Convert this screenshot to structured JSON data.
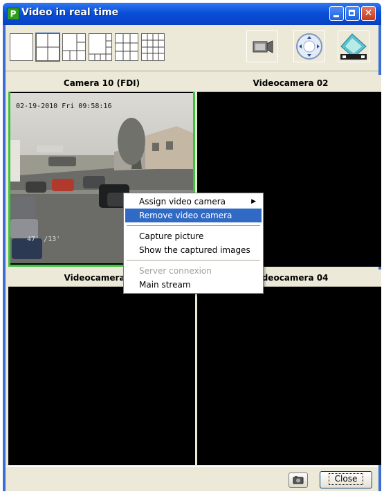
{
  "window": {
    "title": "Video in real time"
  },
  "toolbar": {
    "layout_buttons": [
      "layout-1x1",
      "layout-2x2",
      "layout-1-plus-5",
      "layout-1-plus-7",
      "layout-3x3",
      "layout-4x4"
    ],
    "extra_buttons": [
      "camera-icon",
      "ptz-control-icon",
      "video-playback-icon"
    ]
  },
  "panes": [
    {
      "title": "Camera 10 (FDI)",
      "osd_time": "02-19-2010 Fri 09:58:16",
      "osd_bottom": "47' /13'"
    },
    {
      "title": "Videocamera 02"
    },
    {
      "title": "Videocamera 03"
    },
    {
      "title": "Videocamera 04"
    }
  ],
  "context_menu": {
    "items": [
      {
        "label": "Assign video camera",
        "submenu": true
      },
      {
        "label": "Remove video camera",
        "highlighted": true
      },
      {
        "label": "Capture picture"
      },
      {
        "label": "Show the captured images"
      },
      {
        "label": "Server connexion",
        "disabled": true
      },
      {
        "label": "Main stream"
      }
    ]
  },
  "footer": {
    "close_label": "Close"
  },
  "colors": {
    "title_bar": "#0a4fd8",
    "selection_border": "#3cc43c",
    "menu_highlight": "#316ac5"
  }
}
